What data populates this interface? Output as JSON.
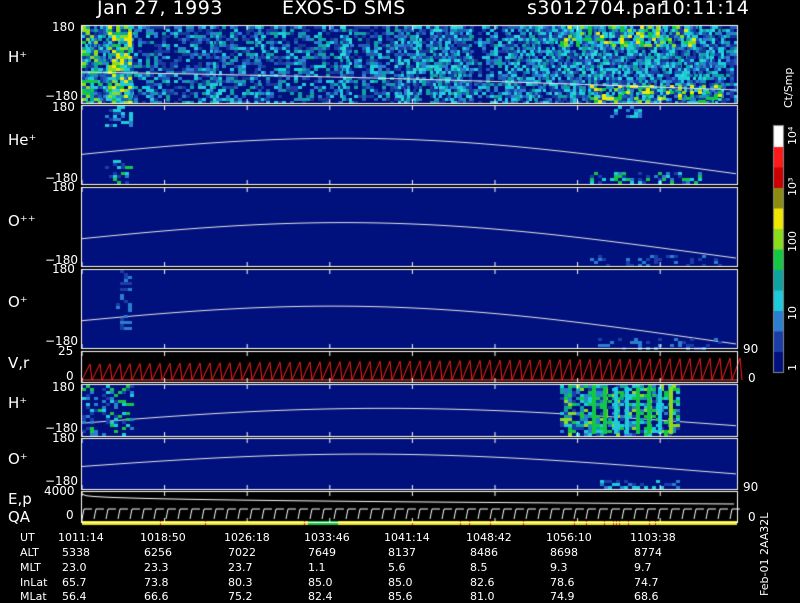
{
  "header": {
    "date": "Jan 27, 1993",
    "instrument": "EXOS-D SMS",
    "file": "s3012704.par",
    "time": "10:11:14"
  },
  "colorbar": {
    "unit_label": "Ct/Smp",
    "tick_labels": [
      "1",
      "10",
      "100",
      "10³",
      "10⁴"
    ],
    "colors": [
      "#00107c",
      "#1b3da9",
      "#2a7fd0",
      "#1ecbd8",
      "#0ea3a0",
      "#14c844",
      "#8cdc1e",
      "#f0e800",
      "#8c8c10",
      "#cc0000",
      "#ff1a1a",
      "#ffffff"
    ]
  },
  "chart_data": {
    "type": "heatmap",
    "x_ticks": [
      "1011:14",
      "1018:50",
      "1026:18",
      "1033:46",
      "1041:14",
      "1048:42",
      "1056:10",
      "1103:38"
    ],
    "panels": [
      {
        "label": "H⁺",
        "y_top": "180",
        "y_bottom": "−180",
        "intensity": "high"
      },
      {
        "label": "He⁺",
        "y_top": "180",
        "y_bottom": "−180",
        "intensity": "low"
      },
      {
        "label": "O⁺⁺",
        "y_top": "180",
        "y_bottom": "−180",
        "intensity": "low"
      },
      {
        "label": "O⁺",
        "y_top": "180",
        "y_bottom": "−180",
        "intensity": "low"
      },
      {
        "label": "V,r",
        "y_top": "25",
        "y_bottom": "0",
        "right_top": "90",
        "right_bottom": "0",
        "type": "line"
      },
      {
        "label": "H⁺",
        "y_top": "180",
        "y_bottom": "−180",
        "intensity": "medium"
      },
      {
        "label": "O⁺",
        "y_top": "180",
        "y_bottom": "−180",
        "intensity": "low"
      },
      {
        "label": "E,p",
        "label2": "QA",
        "y_top": "4000",
        "y_bottom": "0",
        "right_top": "90",
        "right_bottom": "0",
        "type": "line"
      }
    ],
    "ephemeris": {
      "row_labels": [
        "UT",
        "ALT",
        "MLT",
        "InLat",
        "MLat"
      ],
      "UT": [
        "1011:14",
        "1018:50",
        "1026:18",
        "1033:46",
        "1041:14",
        "1048:42",
        "1056:10",
        "1103:38"
      ],
      "ALT": [
        "5338",
        "6256",
        "7022",
        "7649",
        "8137",
        "8486",
        "8698",
        "8774"
      ],
      "MLT": [
        "23.0",
        "23.3",
        "23.7",
        "1.1",
        "5.6",
        "8.5",
        "9.3",
        "9.7"
      ],
      "InLat": [
        "65.7",
        "73.8",
        "80.3",
        "85.0",
        "85.0",
        "82.6",
        "78.6",
        "74.7"
      ],
      "MLat": [
        "56.4",
        "66.6",
        "75.2",
        "82.4",
        "85.6",
        "81.0",
        "74.9",
        "68.6"
      ]
    }
  },
  "footer": {
    "side_stamp": "Feb-01 2AA32L"
  }
}
